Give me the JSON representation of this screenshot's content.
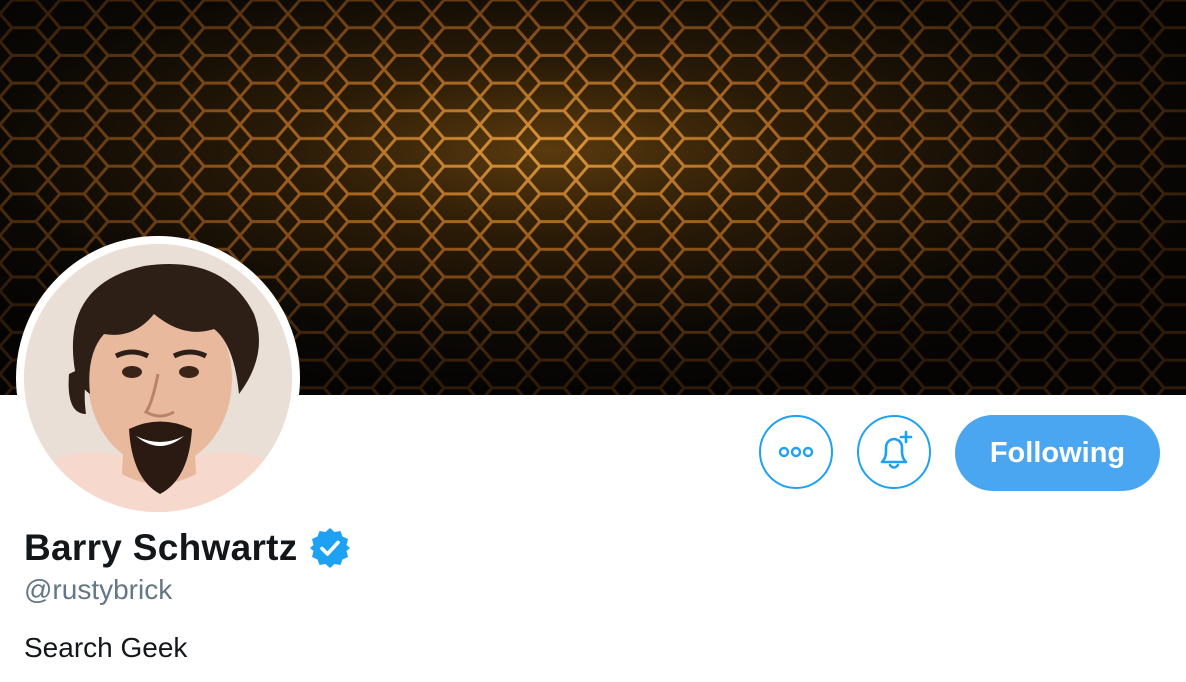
{
  "profile": {
    "display_name": "Barry Schwartz",
    "handle": "@rustybrick",
    "bio": "Search Geek",
    "verified": true
  },
  "actions": {
    "more_icon": "ellipsis-icon",
    "notify_icon": "bell-plus-icon",
    "follow_label": "Following"
  },
  "colors": {
    "accent": "#1da1f2",
    "follow_button": "#4aa6f0",
    "banner_hex": "#b8742a"
  }
}
